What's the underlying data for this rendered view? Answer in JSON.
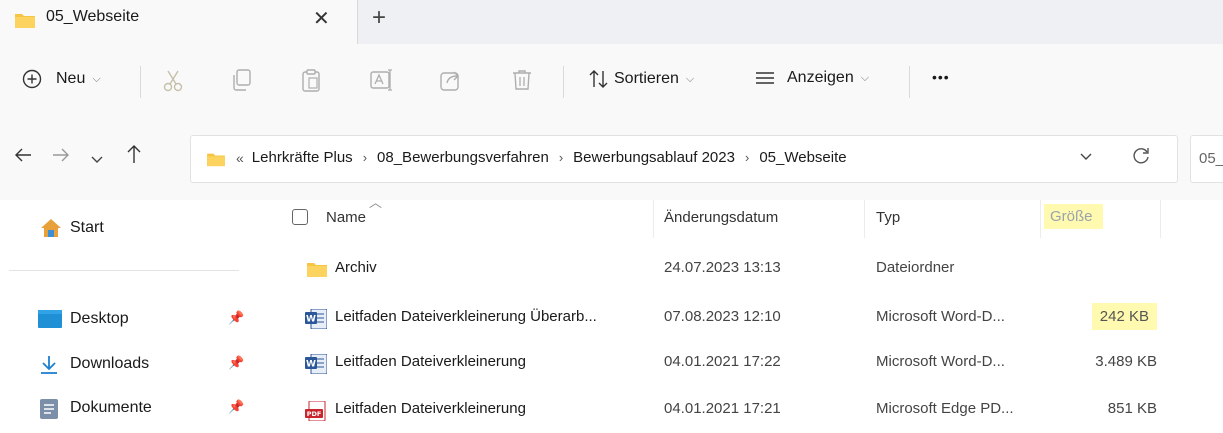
{
  "tab": {
    "title": "05_Webseite",
    "close_glyph": "✕",
    "new_glyph": "+"
  },
  "toolbar": {
    "new_label": "Neu",
    "sort_label": "Sortieren",
    "view_label": "Anzeigen",
    "more_label": "•••",
    "icons": [
      "plus-circle-icon",
      "cut-icon",
      "copy-icon",
      "paste-icon",
      "rename-icon",
      "share-icon",
      "delete-icon",
      "sort-icon",
      "view-icon"
    ]
  },
  "address": {
    "overflow": "«",
    "crumbs": [
      "Lehrkräfte Plus",
      "08_Bewerbungsverfahren",
      "Bewerbungsablauf 2023",
      "05_Webseite"
    ],
    "search_value": "05_"
  },
  "sidebar": {
    "items": [
      {
        "label": "Start",
        "icon": "home-icon"
      },
      {
        "label": "Desktop",
        "icon": "desktop-icon",
        "pinned": true
      },
      {
        "label": "Downloads",
        "icon": "download-icon",
        "pinned": true
      },
      {
        "label": "Dokumente",
        "icon": "documents-icon",
        "pinned": true
      }
    ]
  },
  "columns": {
    "name": "Name",
    "date": "Änderungsdatum",
    "type": "Typ",
    "size": "Größe"
  },
  "files": [
    {
      "name": "Archiv",
      "date": "24.07.2023 13:13",
      "type": "Dateiordner",
      "size": "",
      "icon": "folder-icon"
    },
    {
      "name": "Leitfaden Dateiverkleinerung Überarb...",
      "date": "07.08.2023 12:10",
      "type": "Microsoft Word-D...",
      "size": "242 KB",
      "icon": "word-icon",
      "highlight": true
    },
    {
      "name": "Leitfaden Dateiverkleinerung",
      "date": "04.01.2021 17:22",
      "type": "Microsoft Word-D...",
      "size": "3.489 KB",
      "icon": "word-icon"
    },
    {
      "name": "Leitfaden Dateiverkleinerung",
      "date": "04.01.2021 17:21",
      "type": "Microsoft Edge PD...",
      "size": "851 KB",
      "icon": "pdf-icon"
    }
  ],
  "colors": {
    "highlight": "#fffab0",
    "folder": "#f6c544",
    "word": "#2b579a",
    "pdf": "#c8262c",
    "accent": "#0067c0"
  }
}
